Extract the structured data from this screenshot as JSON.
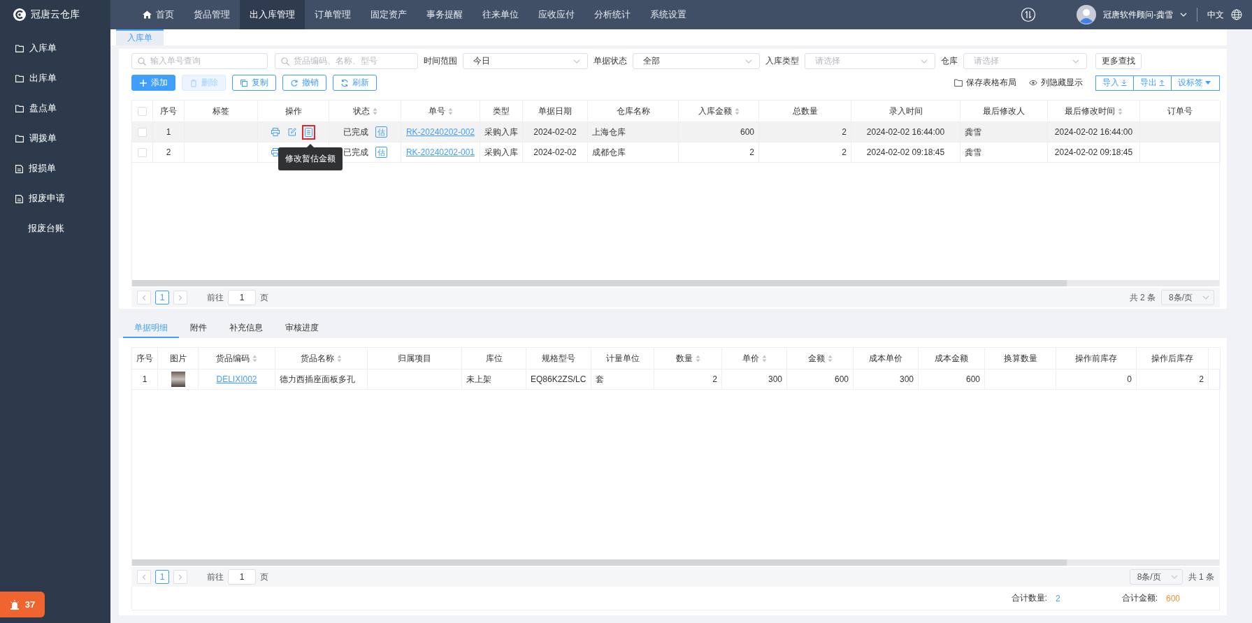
{
  "app": {
    "logo_text": "冠唐云仓库"
  },
  "nav": [
    {
      "label": "首页",
      "kind": "home",
      "selected": false
    },
    {
      "label": "货品管理",
      "kind": "plain",
      "selected": false
    },
    {
      "label": "出入库管理",
      "kind": "plain",
      "selected": true
    },
    {
      "label": "订单管理",
      "kind": "plain",
      "selected": false
    },
    {
      "label": "固定资产",
      "kind": "plain",
      "selected": false
    },
    {
      "label": "事务提醒",
      "kind": "plain",
      "selected": false
    },
    {
      "label": "往来单位",
      "kind": "plain",
      "selected": false
    },
    {
      "label": "应收应付",
      "kind": "plain",
      "selected": false
    },
    {
      "label": "分析统计",
      "kind": "plain",
      "selected": false
    },
    {
      "label": "系统设置",
      "kind": "plain",
      "selected": false
    }
  ],
  "user": {
    "name": "冠唐软件顾问-龚雪",
    "language": "中文"
  },
  "sidebar": {
    "items": [
      {
        "label": "入库单",
        "kind": "folder"
      },
      {
        "label": "出库单",
        "kind": "folder"
      },
      {
        "label": "盘点单",
        "kind": "folder"
      },
      {
        "label": "调拨单",
        "kind": "folder"
      },
      {
        "label": "报损单",
        "kind": "document"
      },
      {
        "label": "报废申请",
        "kind": "document"
      },
      {
        "label": "报废台账",
        "kind": "plain"
      }
    ],
    "notification_badge": {
      "count": "37"
    }
  },
  "page_tabs": [
    {
      "label": "入库单",
      "selected": true
    }
  ],
  "filters": {
    "order_search": {
      "placeholder": "输入单号查询"
    },
    "goods_search": {
      "placeholder": "货品编码、名称、型号"
    },
    "selects": [
      {
        "label": "时间范围",
        "value": "今日"
      },
      {
        "label": "单据状态",
        "value": "全部"
      },
      {
        "label": "入库类型",
        "placeholder": "请选择"
      },
      {
        "label": "仓库",
        "placeholder": "请选择"
      }
    ],
    "more_button": "更多查找"
  },
  "toolbar": {
    "buttons": [
      {
        "label": "添加",
        "kind": "add",
        "disabled": false
      },
      {
        "label": "删除",
        "kind": "delete",
        "disabled": true
      },
      {
        "label": "复制",
        "kind": "copy",
        "disabled": false
      },
      {
        "label": "撤销",
        "kind": "undo",
        "disabled": false
      },
      {
        "label": "刷新",
        "kind": "refresh",
        "disabled": false
      }
    ],
    "links": [
      {
        "label": "保存表格布局",
        "kind": "folder"
      },
      {
        "label": "列隐藏显示",
        "kind": "eye"
      }
    ],
    "group_buttons": [
      {
        "label": "导入",
        "kind": "import"
      },
      {
        "label": "导出",
        "kind": "export"
      },
      {
        "label": "设标签",
        "kind": "dropdown"
      }
    ]
  },
  "orders_table": {
    "select_all_checked": false,
    "columns": [
      {
        "label": "序号",
        "sortable": false
      },
      {
        "label": "标签",
        "sortable": false
      },
      {
        "label": "操作",
        "sortable": false
      },
      {
        "label": "状态",
        "sortable": true
      },
      {
        "label": "单号",
        "sortable": true
      },
      {
        "label": "类型",
        "sortable": false
      },
      {
        "label": "单据日期",
        "sortable": false
      },
      {
        "label": "仓库名称",
        "sortable": false
      },
      {
        "label": "入库金额",
        "sortable": true
      },
      {
        "label": "总数量",
        "sortable": false
      },
      {
        "label": "录入时间",
        "sortable": false
      },
      {
        "label": "最后修改人",
        "sortable": false
      },
      {
        "label": "最后修改时间",
        "sortable": true
      },
      {
        "label": "订单号",
        "sortable": false
      }
    ],
    "rows": [
      {
        "checked": false,
        "hovered": true,
        "estimate_highlighted": true,
        "index": "1",
        "status": "已完成",
        "status_badge": "估",
        "order_no": "RK-20240202-002",
        "type": "采购入库",
        "date": "2024-02-02",
        "warehouse": "上海仓库",
        "amount": "600",
        "quantity": "2",
        "created_at": "2024-02-02 16:44:00",
        "modified_by": "龚雪",
        "modified_at": "2024-02-02 16:44:00"
      },
      {
        "checked": false,
        "hovered": false,
        "estimate_highlighted": false,
        "index": "2",
        "status": "已完成",
        "status_badge": "估",
        "order_no": "RK-20240202-001",
        "type": "采购入库",
        "date": "2024-02-02",
        "warehouse": "成都仓库",
        "amount": "2",
        "quantity": "2",
        "created_at": "2024-02-02 09:18:45",
        "modified_by": "龚雪",
        "modified_at": "2024-02-02 09:18:45"
      }
    ],
    "tooltip": {
      "text": "修改暂估金额"
    }
  },
  "orders_pagination": {
    "pages": [
      {
        "label": "1",
        "selected": true
      }
    ],
    "goto_label": "前往",
    "goto_value": "1",
    "page_unit": "页",
    "total": "共 2 条",
    "page_size": "8条/页"
  },
  "detail_tabs": [
    {
      "label": "单据明细",
      "selected": true
    },
    {
      "label": "附件",
      "selected": false
    },
    {
      "label": "补充信息",
      "selected": false
    },
    {
      "label": "审核进度",
      "selected": false
    }
  ],
  "detail_table": {
    "columns": [
      {
        "label": "序号",
        "sortable": false
      },
      {
        "label": "图片",
        "sortable": false
      },
      {
        "label": "货品编码",
        "sortable": true
      },
      {
        "label": "货品名称",
        "sortable": true
      },
      {
        "label": "归属项目",
        "sortable": false
      },
      {
        "label": "库位",
        "sortable": false
      },
      {
        "label": "规格型号",
        "sortable": false
      },
      {
        "label": "计量单位",
        "sortable": false
      },
      {
        "label": "数量",
        "sortable": true
      },
      {
        "label": "单价",
        "sortable": true
      },
      {
        "label": "金额",
        "sortable": true
      },
      {
        "label": "成本单价",
        "sortable": false
      },
      {
        "label": "成本金额",
        "sortable": false
      },
      {
        "label": "换算数量",
        "sortable": false
      },
      {
        "label": "操作前库存",
        "sortable": false
      },
      {
        "label": "操作后库存",
        "sortable": false
      }
    ],
    "rows": [
      {
        "index": "1",
        "code": "DELIXI002",
        "name": "德力西插座面板多孔",
        "location": "未上架",
        "spec": "EQ86K2ZS/LC",
        "unit": "套",
        "quantity": "2",
        "price": "300",
        "amount": "600",
        "cost_price": "300",
        "cost_amount": "600",
        "stock_before": "0",
        "stock_after": "2"
      }
    ]
  },
  "detail_pagination": {
    "pages": [
      {
        "label": "1",
        "selected": true
      }
    ],
    "goto_label": "前往",
    "goto_value": "1",
    "page_unit": "页",
    "total": "共 1 条",
    "page_size": "8条/页"
  },
  "totals": [
    {
      "label": "合计数量:",
      "value": "2",
      "kind": "quantity"
    },
    {
      "label": "合计金额:",
      "value": "600",
      "kind": "amount"
    }
  ]
}
